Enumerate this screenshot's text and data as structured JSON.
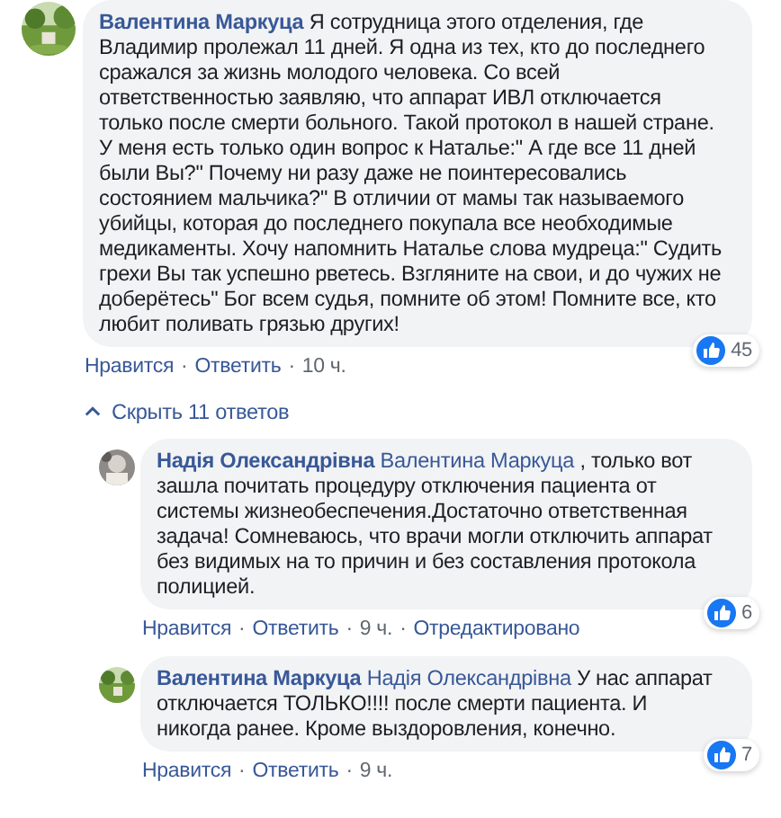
{
  "separator": "·",
  "comment": {
    "author": "Валентина Маркуца",
    "text": "Я сотрудница этого отделения, где Владимир пролежал 11 дней. Я одна из тех, кто до последнего сражался за жизнь молодого человека. Со всей ответственностью заявляю, что аппарат ИВЛ отключается только после смерти больного. Такой протокол в нашей стране. У меня есть только один вопрос к Наталье:\" А где все 11 дней были Вы?\" Почему ни разу даже не поинтересовались состоянием мальчика?\" В отличии от мамы так называемого убийцы, которая до последнего покупала все необходимые медикаменты. Хочу напомнить Наталье слова мудреца:\" Судить грехи Вы так успешно рветесь. Взгляните на свои, и до чужих не доберётесь\" Бог всем судья, помните об этом! Помните все, кто любит поливать грязью других!",
    "actions": [
      "Нравится",
      "Ответить"
    ],
    "time": "10 ч.",
    "likes": "45"
  },
  "replies_toggle": "Скрыть 11 ответов",
  "replies": [
    {
      "author": "Надія Олександрівна",
      "mention": "Валентина Маркуца",
      "text": ", только вот зашла почитать процедуру отключения пациента от системы жизнеобеспечения.Достаточно ответственная задача! Сомневаюсь, что врачи могли отключить аппарат без видимых на то причин и без составления протокола полицией.",
      "actions": [
        "Нравится",
        "Ответить"
      ],
      "time": "9 ч.",
      "edited": "Отредактировано",
      "likes": "6"
    },
    {
      "author": "Валентина Маркуца",
      "mention": "Надія Олександрівна",
      "text": "У нас аппарат отключается ТОЛЬКО!!!! после смерти пациента. И никогда ранее. Кроме выздоровления, конечно.",
      "actions": [
        "Нравится",
        "Ответить"
      ],
      "time": "9 ч.",
      "likes": "7"
    }
  ]
}
